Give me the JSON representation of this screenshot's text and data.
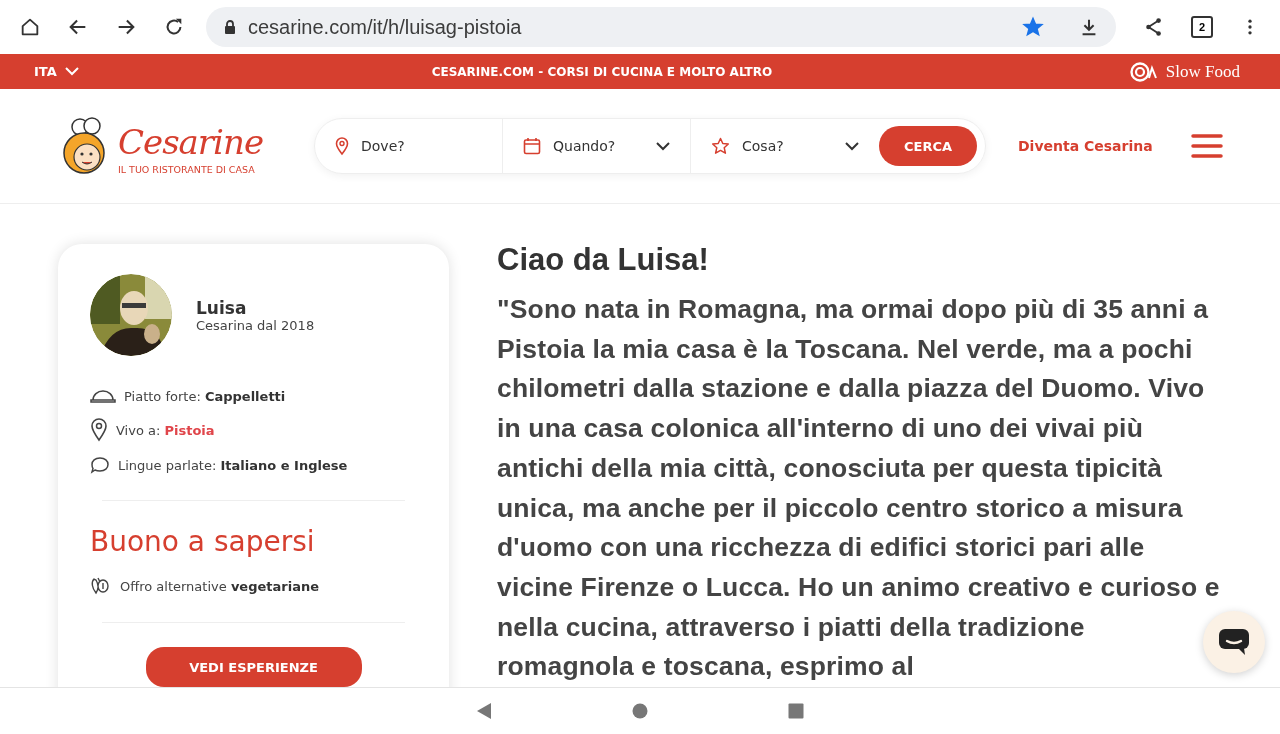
{
  "browser": {
    "url": "cesarine.com/it/h/luisag-pistoia",
    "tab_count": "2",
    "bookmarked": true
  },
  "top_bar": {
    "language": "ITA",
    "tagline": "CESARINE.COM - CORSI DI CUCINA E MOLTO ALTRO",
    "partner": "Slow Food"
  },
  "header": {
    "logo": {
      "name": "Cesarine",
      "subtitle": "IL TUO RISTORANTE DI CASA"
    },
    "search": {
      "fields": [
        {
          "kind": "place",
          "placeholder": "Dove?",
          "dropdown": false
        },
        {
          "kind": "date",
          "placeholder": "Quando?",
          "dropdown": true
        },
        {
          "kind": "category",
          "placeholder": "Cosa?",
          "dropdown": true
        }
      ],
      "button": "CERCA"
    },
    "link": "Diventa Cesarina"
  },
  "profile": {
    "name": "Luisa",
    "since": "Cesarina dal 2018",
    "facts": [
      {
        "kind": "dish",
        "label": "Piatto forte:",
        "value": "Cappelletti",
        "highlighted": false
      },
      {
        "kind": "place",
        "label": "Vivo a:",
        "value": "Pistoia",
        "highlighted": true
      },
      {
        "kind": "language",
        "label": "Lingue parlate:",
        "value": "Italiano e Inglese",
        "highlighted": false
      }
    ],
    "good_to_know": {
      "title": "Buono a sapersi",
      "items": [
        {
          "kind": "vegetarian",
          "label": "Offro alternative",
          "value": "vegetariane"
        }
      ]
    },
    "button": "VEDI ESPERIENZE"
  },
  "about": {
    "title": "Ciao da Luisa!",
    "text": "\"Sono nata in Romagna, ma ormai dopo più di 35 anni a Pistoia la mia casa è la Toscana. Nel verde, ma a pochi chilometri dalla stazione e dalla piazza del Duomo. Vivo in una casa colonica all'interno di uno dei vivai più antichi della mia città, conosciuta per questa tipicità unica, ma anche per il piccolo centro storico a misura d'uomo con una ricchezza di edifici storici pari alle vicine Firenze o Lucca. Ho un animo creativo e curioso e nella cucina, attraverso i piatti della tradizione romagnola e toscana, esprimo al"
  }
}
